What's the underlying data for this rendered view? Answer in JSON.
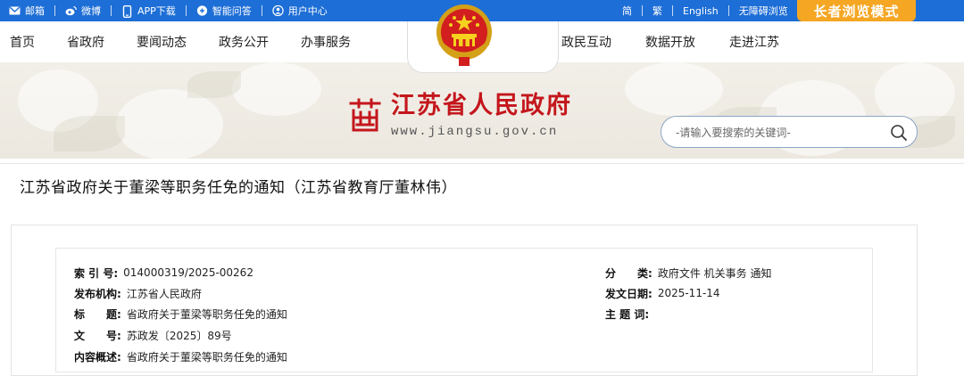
{
  "topbar": {
    "left": [
      {
        "icon": "mail-icon",
        "label": "邮箱"
      },
      {
        "icon": "weibo-icon",
        "label": "微博"
      },
      {
        "icon": "phone-icon",
        "label": "APP下载"
      },
      {
        "icon": "chat-icon",
        "label": "智能问答"
      },
      {
        "icon": "user-icon",
        "label": "用户中心"
      }
    ],
    "right": [
      "简",
      "繁",
      "English",
      "无障碍浏览"
    ],
    "elder_mode": "长者浏览模式"
  },
  "nav": {
    "left": [
      "首页",
      "省政府",
      "要闻动态",
      "政务公开",
      "办事服务"
    ],
    "right": [
      "政民互动",
      "数据开放",
      "走进江苏"
    ]
  },
  "site": {
    "name_cn": "江苏省人民政府",
    "domain": "www.jiangsu.gov.cn"
  },
  "search": {
    "placeholder": "-请输入要搜索的关键词-"
  },
  "article": {
    "title": "江苏省政府关于董梁等职务任免的通知（江苏省教育厅董林伟）"
  },
  "meta": {
    "left": [
      {
        "label": "索 引 号:",
        "value": "014000319/2025-00262"
      },
      {
        "label": "发布机构:",
        "value": "江苏省人民政府"
      },
      {
        "label": "标　　题:",
        "value": "省政府关于董梁等职务任免的通知"
      },
      {
        "label": "文　　号:",
        "value": "苏政发〔2025〕89号"
      },
      {
        "label": "内容概述:",
        "value": "省政府关于董梁等职务任免的通知"
      }
    ],
    "right": [
      {
        "label": "分　　类:",
        "value": "政府文件 机关事务 通知"
      },
      {
        "label": "发文日期:",
        "value": "2025-11-14"
      },
      {
        "label": "主 题 词:",
        "value": ""
      }
    ]
  },
  "colors": {
    "topbar_bg": "#1d6ed6",
    "elder_bg": "#f5a623",
    "brand_red": "#c4161c"
  }
}
